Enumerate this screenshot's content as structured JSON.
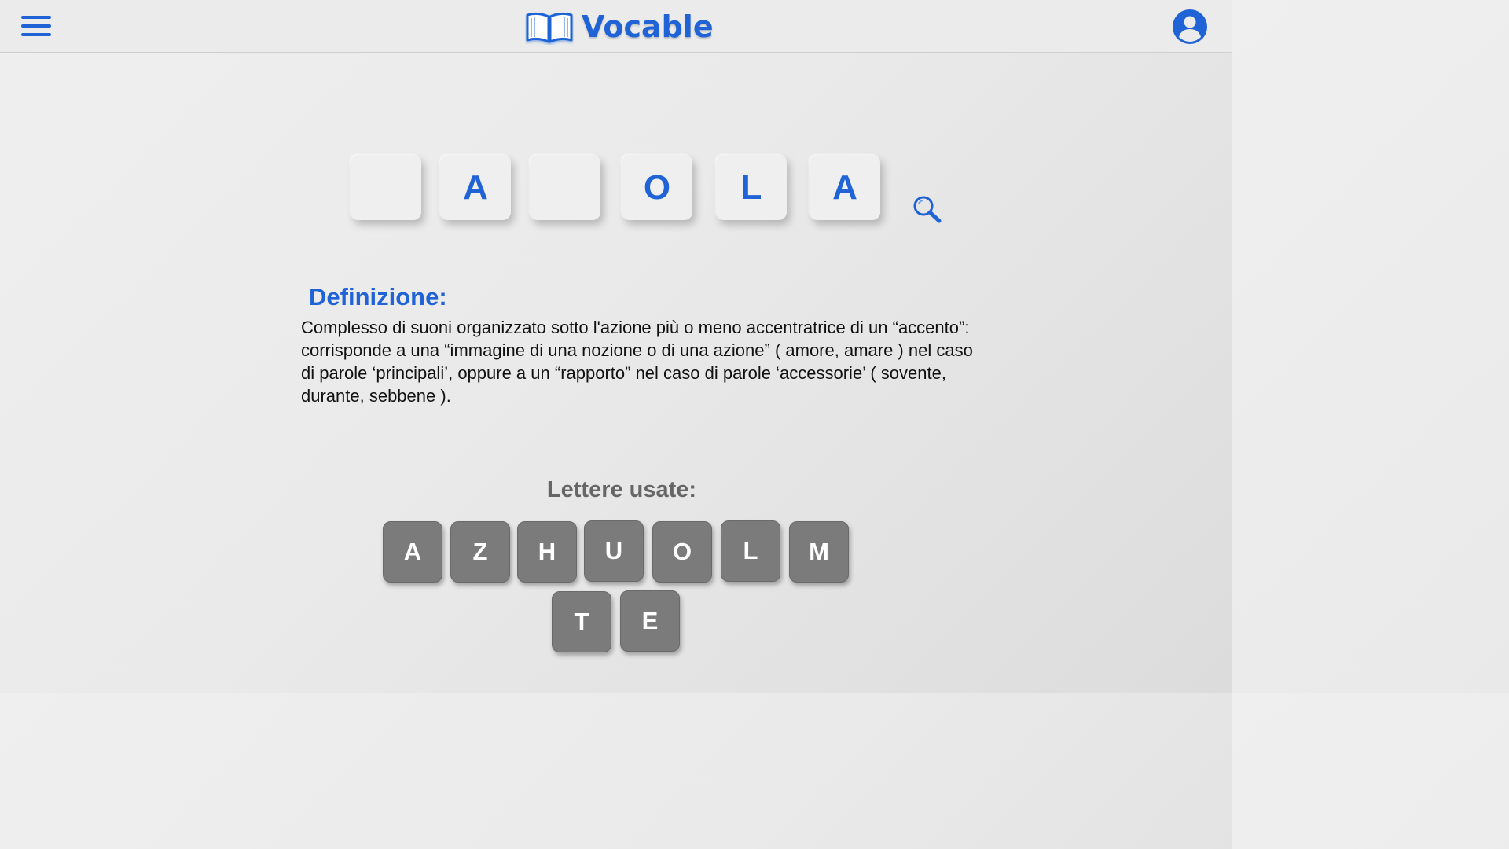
{
  "app": {
    "title": "Vocable"
  },
  "colors": {
    "accent": "#1f63d6",
    "key_background": "#7b7b7b",
    "tile_background": "#efefef",
    "used_title": "#666666"
  },
  "icons": {
    "menu": "hamburger-menu-icon",
    "logo": "open-book-icon",
    "user": "user-account-icon",
    "search": "magnifier-icon"
  },
  "word_tiles": [
    "",
    "A",
    "",
    "O",
    "L",
    "A"
  ],
  "definition": {
    "title": "Definizione:",
    "text": "Complesso di suoni organizzato sotto l'azione più o meno accentratrice  di un “accento”: corrisponde a una “immagine di una nozione o di una azione” ( amore, amare ) nel caso di parole ‘principali’, oppure a un “rapporto” nel caso di parole ‘accessorie’ ( sovente, durante, sebbene )."
  },
  "used_letters": {
    "title": "Lettere usate:",
    "letters": [
      "A",
      "Z",
      "H",
      "U",
      "O",
      "L",
      "M",
      "T",
      "E"
    ]
  }
}
